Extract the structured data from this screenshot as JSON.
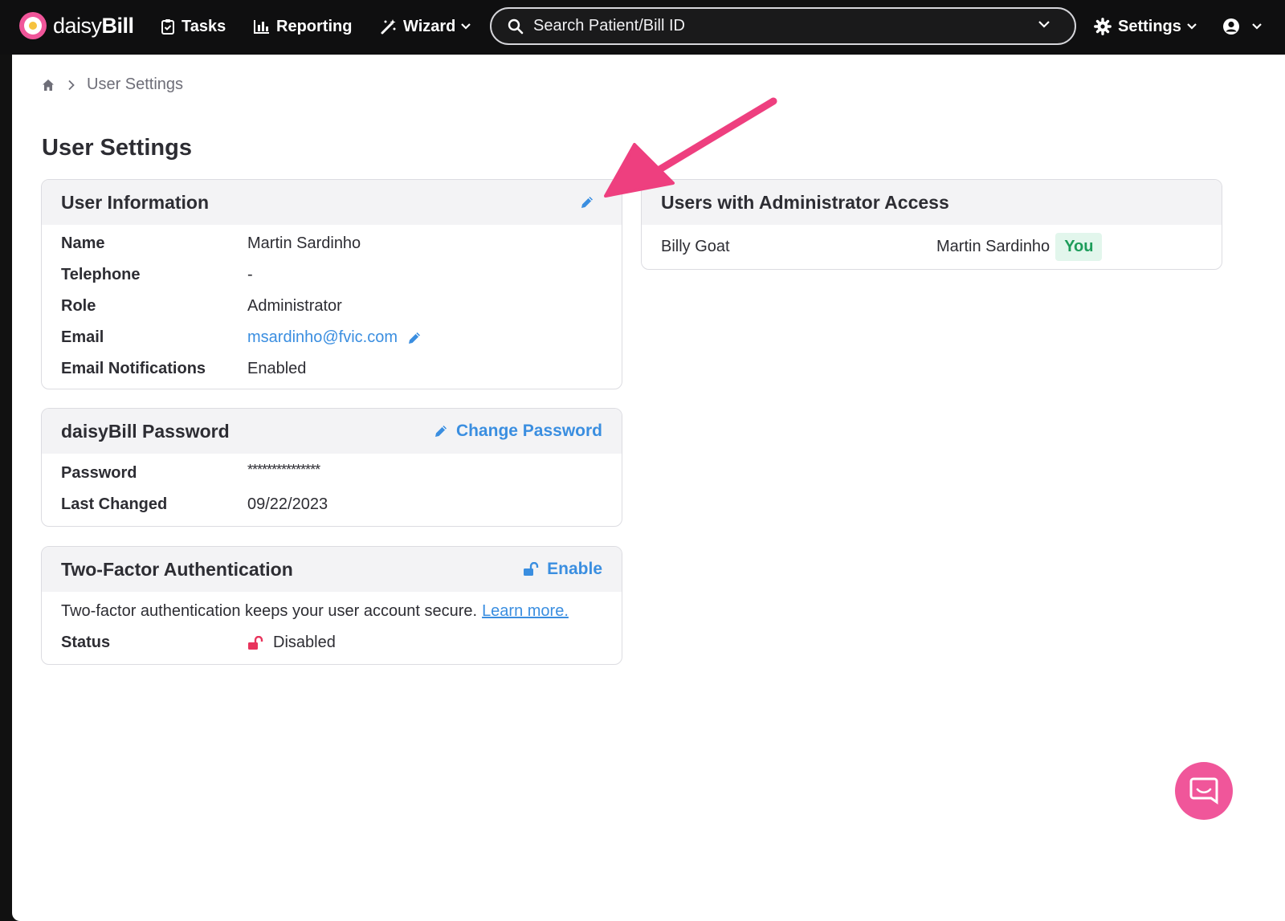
{
  "brand": {
    "prefix": "daisy",
    "suffix": "Bill"
  },
  "nav": {
    "tasks": "Tasks",
    "reporting": "Reporting",
    "wizard": "Wizard",
    "settings": "Settings"
  },
  "search": {
    "placeholder": "Search Patient/Bill ID"
  },
  "breadcrumb": {
    "current": "User Settings"
  },
  "page_title": "User Settings",
  "user_info": {
    "title": "User Information",
    "rows": [
      {
        "label": "Name",
        "value": "Martin Sardinho"
      },
      {
        "label": "Telephone",
        "value": "-"
      },
      {
        "label": "Role",
        "value": "Administrator"
      },
      {
        "label": "Email",
        "value": "msardinho@fvic.com"
      },
      {
        "label": "Email Notifications",
        "value": "Enabled"
      }
    ]
  },
  "password": {
    "title": "daisyBill Password",
    "action": "Change Password",
    "rows": [
      {
        "label": "Password",
        "value": "***************"
      },
      {
        "label": "Last Changed",
        "value": "09/22/2023"
      }
    ]
  },
  "two_factor": {
    "title": "Two-Factor Authentication",
    "action": "Enable",
    "description": "Two-factor authentication keeps your user account secure.",
    "learn_more": "Learn more.",
    "status_label": "Status",
    "status_value": "Disabled"
  },
  "admins": {
    "title": "Users with Administrator Access",
    "users": [
      {
        "name": "Billy Goat"
      },
      {
        "name": "Martin Sardinho",
        "badge": "You"
      }
    ]
  },
  "colors": {
    "nav_bg": "#0f0f10",
    "accent_blue": "#3a8ee0",
    "brand_pink": "#f0569a",
    "annotation_pink": "#ee3f7f",
    "badge_green": "#1d9c5a",
    "badge_green_bg": "#e2f6ec",
    "disabled_red": "#e8345c"
  },
  "icons": {
    "tasks": "clipboard-check-icon",
    "reporting": "bar-chart-icon",
    "wizard": "magic-wand-icon",
    "search": "search-icon",
    "settings": "gear-icon",
    "user": "user-circle-icon",
    "edit": "pencil-icon",
    "lock_open": "lock-open-icon",
    "chat": "chat-icon"
  }
}
